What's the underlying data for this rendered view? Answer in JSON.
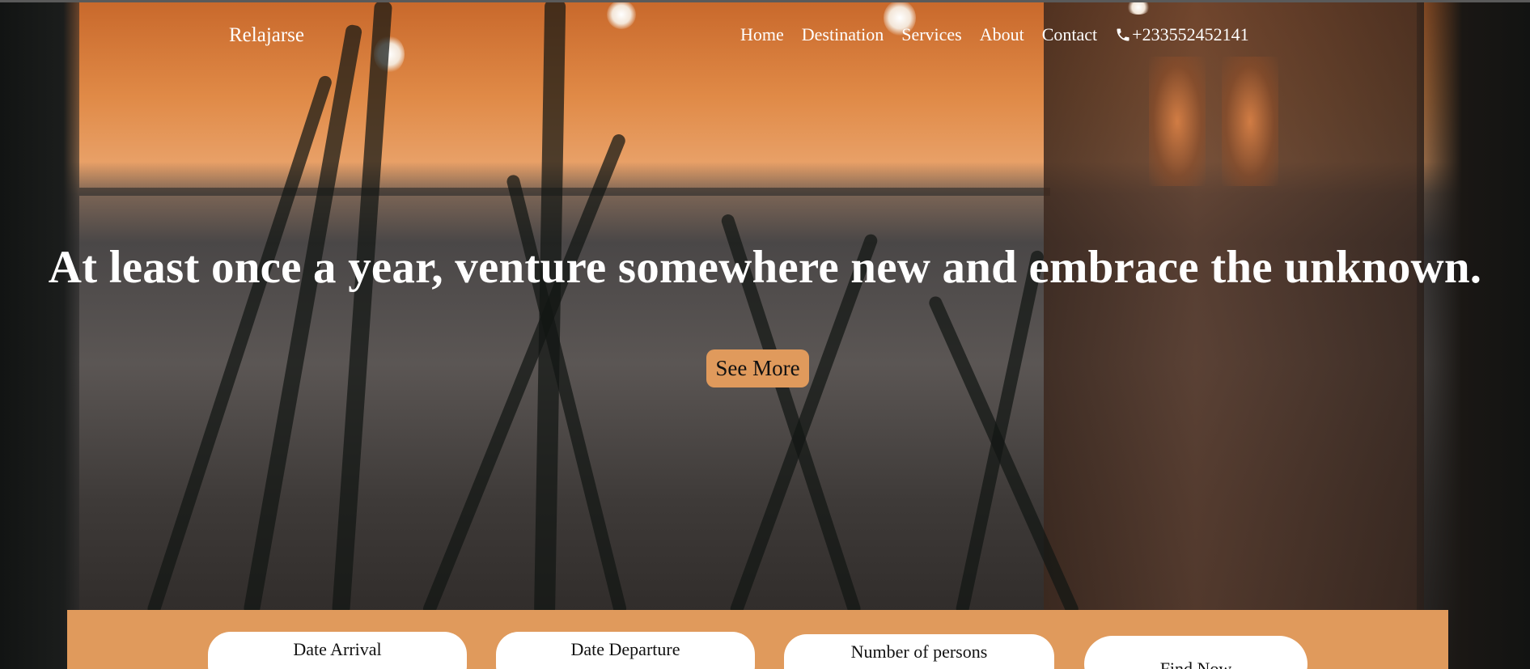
{
  "brand": "Relajarse",
  "nav": {
    "links": [
      "Home",
      "Destination",
      "Services",
      "About",
      "Contact"
    ],
    "phone": "+233552452141",
    "phone_icon": "phone-icon"
  },
  "hero": {
    "title": "At least once a year, venture somewhere new and embrace the unknown.",
    "cta_label": "See More"
  },
  "booking": {
    "arrival_label": "Date Arrival",
    "departure_label": "Date Departure",
    "persons_label": "Number of persons",
    "find_label": "Find Now"
  },
  "colors": {
    "accent": "#e09a5c",
    "text_light": "#ffffff",
    "text_dark": "#111111"
  }
}
